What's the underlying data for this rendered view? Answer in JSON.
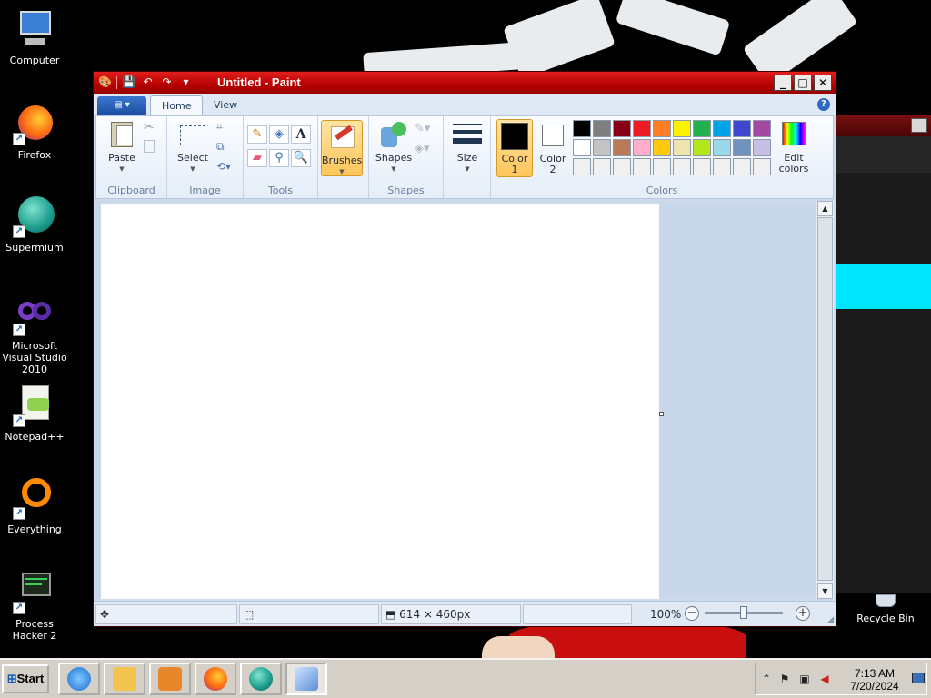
{
  "desktop": {
    "icons": [
      {
        "label": "Computer"
      },
      {
        "label": "Firefox"
      },
      {
        "label": "Supermium"
      },
      {
        "label": "Microsoft Visual Studio 2010"
      },
      {
        "label": "Notepad++"
      },
      {
        "label": "Everything"
      },
      {
        "label": "Process Hacker 2"
      },
      {
        "label": "Recycle Bin"
      }
    ]
  },
  "paint": {
    "title": "Untitled - Paint",
    "tabs": [
      {
        "label": "Home"
      },
      {
        "label": "View"
      }
    ],
    "ribbon": {
      "clipboard": {
        "label": "Clipboard",
        "paste": "Paste"
      },
      "image": {
        "label": "Image",
        "select": "Select"
      },
      "tools": {
        "label": "Tools"
      },
      "brushes": {
        "label": "Brushes"
      },
      "shapes": {
        "label": "Shapes",
        "button": "Shapes"
      },
      "size": {
        "label": "Size"
      },
      "colors": {
        "label": "Colors",
        "color1": "Color 1",
        "color2": "Color 2",
        "edit": "Edit colors",
        "color1_value": "#000000",
        "color2_value": "#ffffff",
        "swatches": [
          "#000000",
          "#7f7f7f",
          "#880015",
          "#ed1c24",
          "#ff7f27",
          "#fff200",
          "#22b14c",
          "#00a2e8",
          "#3f48cc",
          "#a349a4",
          "#ffffff",
          "#c3c3c3",
          "#b97a57",
          "#ffaec9",
          "#ffc90e",
          "#efe4b0",
          "#b5e61d",
          "#99d9ea",
          "#7092be",
          "#c8bfe7",
          "#f0f0f0",
          "#f0f0f0",
          "#f0f0f0",
          "#f0f0f0",
          "#f0f0f0",
          "#f0f0f0",
          "#f0f0f0",
          "#f0f0f0",
          "#f0f0f0",
          "#f0f0f0"
        ]
      }
    },
    "status": {
      "dimensions": "614 × 460px",
      "zoom": "100%",
      "zoom_level": 0.5
    }
  },
  "taskbar": {
    "start": "Start",
    "time": "7:13 AM",
    "date": "7/20/2024"
  }
}
